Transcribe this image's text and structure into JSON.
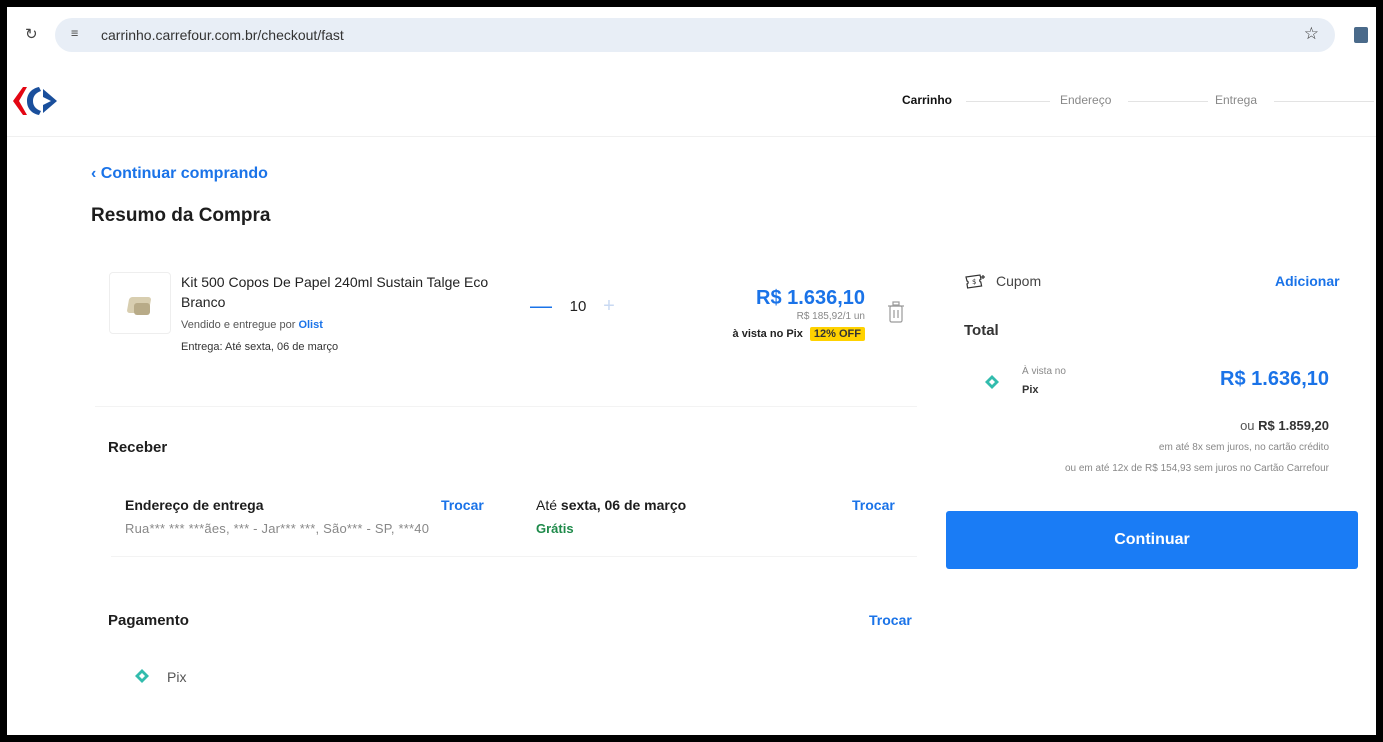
{
  "browser": {
    "url": "carrinho.carrefour.com.br/checkout/fast"
  },
  "steps": [
    "Carrinho",
    "Endereço",
    "Entrega"
  ],
  "back_link": "Continuar comprando",
  "page_title": "Resumo da Compra",
  "product": {
    "name": "Kit 500 Copos De Papel 240ml Sustain Talge Eco Branco",
    "sold_by_prefix": "Vendido e entregue por",
    "seller": "Olist",
    "delivery": "Entrega: Até sexta, 06 de março",
    "quantity": "10",
    "qty_minus": "—",
    "qty_plus": "+",
    "price": "R$ 1.636,10",
    "unit_price": "R$ 185,92/1 un",
    "pix_label": "à vista no Pix",
    "discount": "12% OFF"
  },
  "receber": {
    "title": "Receber",
    "address_label": "Endereço de entrega",
    "address_change": "Trocar",
    "address": "Rua*** *** ***ães, *** - Jar*** ***, São*** - SP, ***40",
    "shipping_prefix": "Até",
    "shipping_date": "sexta, 06 de março",
    "shipping_price": "Grátis",
    "shipping_change": "Trocar"
  },
  "pagamento": {
    "title": "Pagamento",
    "change": "Trocar",
    "method": "Pix"
  },
  "summary": {
    "coupon_label": "Cupom",
    "coupon_action": "Adicionar",
    "total_label": "Total",
    "pix_small": "À vista no",
    "pix_bold": "Pix",
    "total_value": "R$ 1.636,10",
    "alt_prefix": "ou",
    "alt_value": "R$ 1.859,20",
    "installments_1": "em até 8x sem juros, no cartão crédito",
    "installments_2": "ou em até 12x de R$ 154,93 sem juros no Cartão Carrefour",
    "continue_button": "Continuar"
  },
  "colors": {
    "brand_blue": "#1a73e8",
    "button_blue": "#1a7cf5",
    "discount_yellow": "#ffd200",
    "free_green": "#1e8a4a",
    "pix_teal": "#32bcad",
    "logo_red": "#e30613"
  }
}
